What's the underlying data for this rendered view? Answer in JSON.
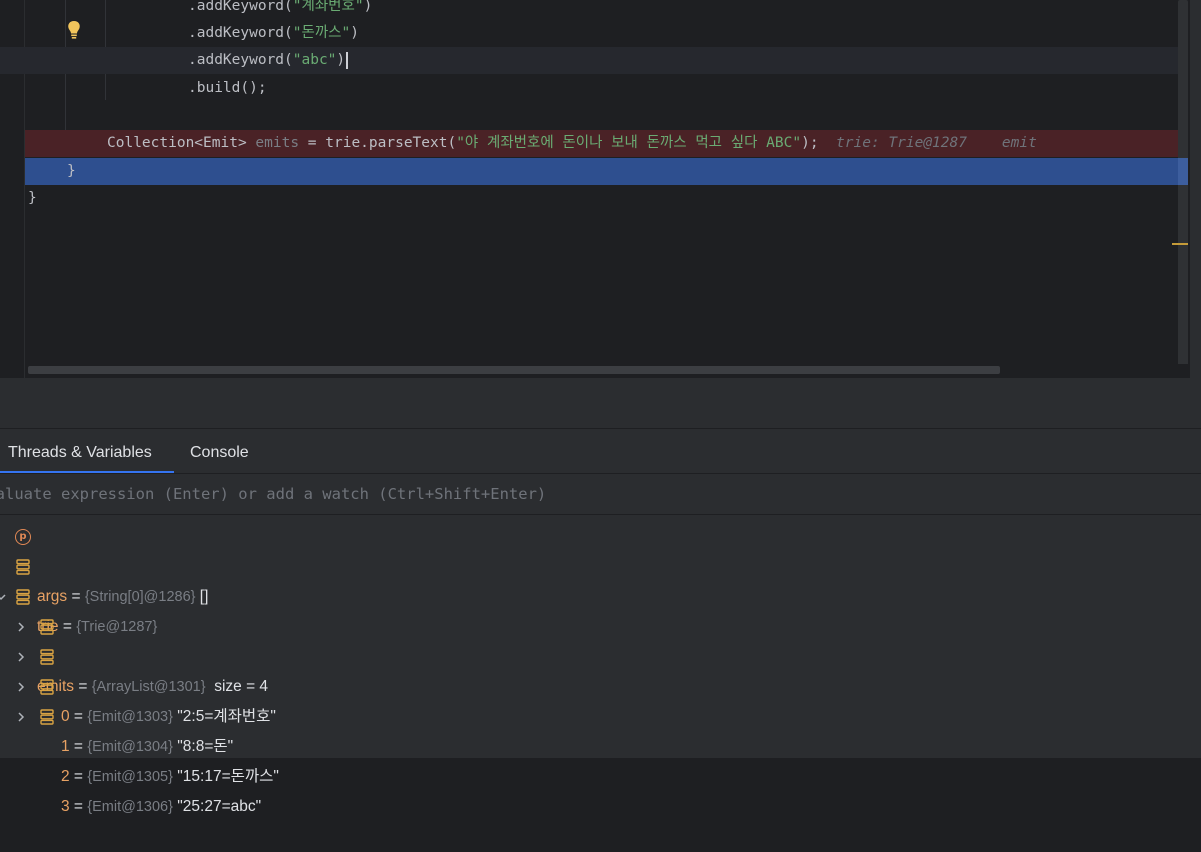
{
  "editor": {
    "lines": [
      {
        "prefix": ".addKeyword(",
        "str": "\"계좌번호\"",
        "suffix": ")"
      },
      {
        "prefix": ".addKeyword(",
        "str": "\"돈까스\"",
        "suffix": ")"
      },
      {
        "prefix": ".addKeyword(",
        "str": "\"abc\"",
        "suffix": ")"
      },
      {
        "prefix": ".build();",
        "str": "",
        "suffix": ""
      },
      {
        "prefix": "",
        "str": "",
        "suffix": ""
      },
      {
        "prefix": "Collection<Emit> ",
        "var": "emits",
        "mid": " = trie.parseText(",
        "str": "\"야 계좌번호에 돈이나 보내 돈까스 먹고 싶다 ABC\"",
        "suffix": ");",
        "hint1": "trie: Trie@1287",
        "hint2": "emit"
      },
      {
        "prefix": "}",
        "str": "",
        "suffix": ""
      },
      {
        "prefix": "}",
        "str": "",
        "suffix": ""
      }
    ]
  },
  "debugger": {
    "tabs": [
      "Threads & Variables",
      "Console"
    ],
    "eval_placeholder": "Evaluate expression (Enter) or add a watch (Ctrl+Shift+Enter)",
    "variables": [
      {
        "name": "args",
        "eq": " = ",
        "type": "{String[0]@1286}",
        "value": " []",
        "icon": "parameter-icon"
      },
      {
        "name": "trie",
        "eq": " = ",
        "type": "{Trie@1287}",
        "value": "",
        "icon": "field-icon"
      },
      {
        "name": "emits",
        "eq": " = ",
        "type": "{ArrayList@1301}",
        "value": "  size = 4",
        "icon": "field-icon"
      }
    ],
    "children": [
      {
        "name": "0",
        "eq": " = ",
        "type": "{Emit@1303}",
        "value": " \"2:5=계좌번호\""
      },
      {
        "name": "1",
        "eq": " = ",
        "type": "{Emit@1304}",
        "value": " \"8:8=돈\""
      },
      {
        "name": "2",
        "eq": " = ",
        "type": "{Emit@1305}",
        "value": " \"15:17=돈까스\""
      },
      {
        "name": "3",
        "eq": " = ",
        "type": "{Emit@1306}",
        "value": " \"25:27=abc\""
      }
    ]
  },
  "colors": {
    "editor_bg": "#1e1f22",
    "panel_bg": "#2b2d30",
    "string": "#6aab73",
    "exec_line": "#2e4f8f",
    "breakpoint_line": "#4a2226",
    "accent": "#3574f0"
  }
}
